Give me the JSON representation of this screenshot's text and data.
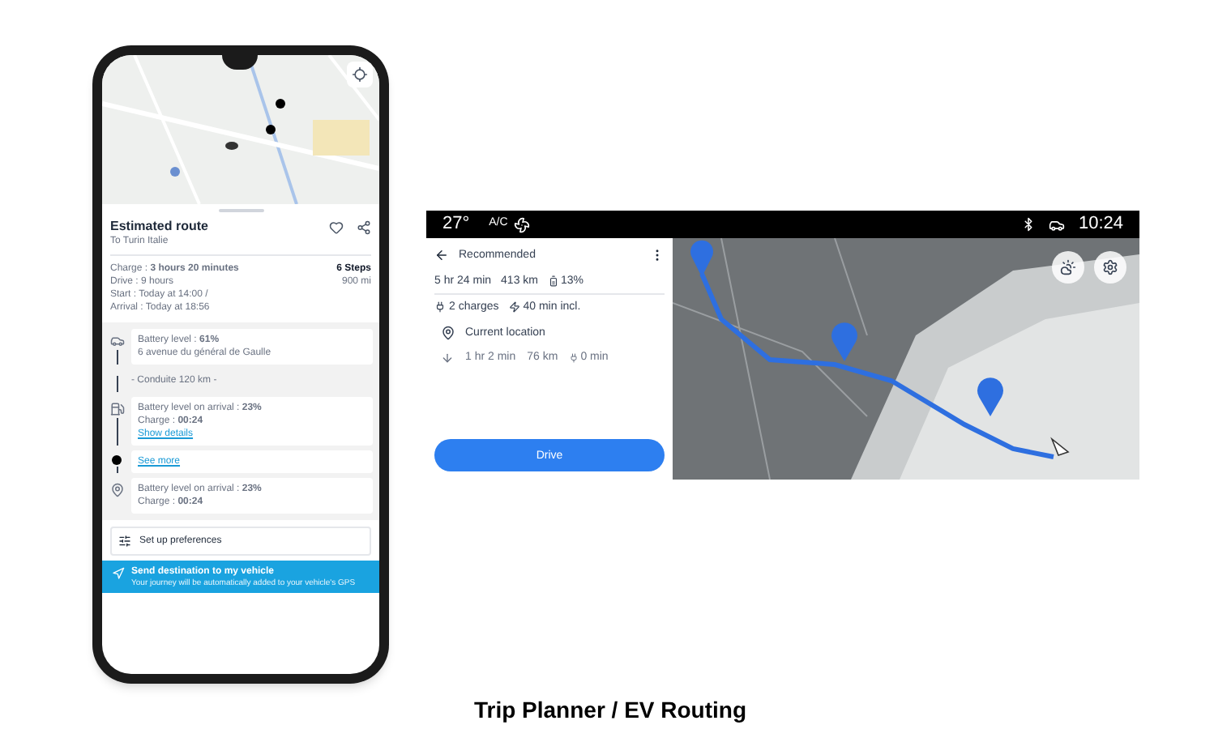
{
  "phone": {
    "route": {
      "title": "Estimated route",
      "subtitle": "To Turin Italie",
      "charge": "Charge : **3 hours 20 minutes**",
      "steps": "6 Steps",
      "drive": "Drive : 9 hours",
      "distance": "900 mi",
      "start": "Start : Today at 14:00 /",
      "arrival": "Arrival : Today at 18:56"
    },
    "stops": [
      {
        "kind": "start",
        "line1": "Battery level : **61%**",
        "line2": "6 avenue du général de Gaulle"
      },
      {
        "kind": "note",
        "line1": "- Conduite 120 km -"
      },
      {
        "kind": "charge",
        "line1": "Battery level on arrival : **23%**",
        "line2": "Charge : **00:24**",
        "link": "Show details"
      },
      {
        "kind": "more",
        "link": "See more"
      },
      {
        "kind": "end",
        "line1": "Battery level on arrival : **23%**",
        "line2": "Charge : **00:24**"
      }
    ],
    "preferences": "Set up preferences",
    "send": {
      "title": "Send destination to my vehicle",
      "body": "Your journey will be automatically added to your vehicle's GPS"
    }
  },
  "car": {
    "status": {
      "temperature": "27°",
      "ac": "A/C",
      "time": "10:24"
    },
    "panel": {
      "title": "Recommended",
      "duration": "5 hr 24 min",
      "distance": "413 km",
      "battery": "13%",
      "charges": "2 charges",
      "charge_time": "40 min incl.",
      "origin": "Current location",
      "leg_duration": "1 hr 2 min",
      "leg_distance": "76 km",
      "leg_charge": "0 min",
      "drive_button": "Drive"
    }
  },
  "caption": "Trip Planner / EV Routing"
}
